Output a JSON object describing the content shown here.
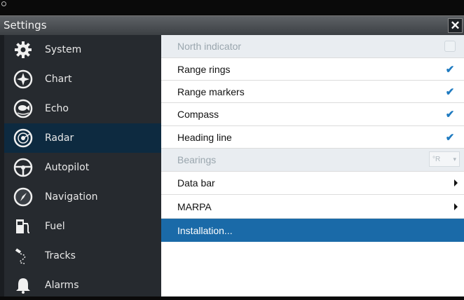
{
  "window": {
    "title": "Settings",
    "close_icon": "close-icon"
  },
  "sidebar": {
    "items": [
      {
        "label": "System",
        "icon": "gear-icon",
        "selected": false
      },
      {
        "label": "Chart",
        "icon": "chart-compass-icon",
        "selected": false
      },
      {
        "label": "Echo",
        "icon": "echo-fish-icon",
        "selected": false
      },
      {
        "label": "Radar",
        "icon": "radar-icon",
        "selected": true
      },
      {
        "label": "Autopilot",
        "icon": "steering-wheel-icon",
        "selected": false
      },
      {
        "label": "Navigation",
        "icon": "compass-needle-icon",
        "selected": false
      },
      {
        "label": "Fuel",
        "icon": "fuel-pump-icon",
        "selected": false
      },
      {
        "label": "Tracks",
        "icon": "tracks-icon",
        "selected": false
      },
      {
        "label": "Alarms",
        "icon": "bell-icon",
        "selected": false
      }
    ]
  },
  "options": [
    {
      "label": "North indicator",
      "control": "checkbox",
      "checked": false,
      "disabled": true
    },
    {
      "label": "Range rings",
      "control": "checkbox",
      "checked": true,
      "disabled": false
    },
    {
      "label": "Range markers",
      "control": "checkbox",
      "checked": true,
      "disabled": false
    },
    {
      "label": "Compass",
      "control": "checkbox",
      "checked": true,
      "disabled": false
    },
    {
      "label": "Heading line",
      "control": "checkbox",
      "checked": true,
      "disabled": false
    },
    {
      "label": "Bearings",
      "control": "dropdown",
      "value": "°R",
      "disabled": true
    },
    {
      "label": "Data bar",
      "control": "submenu",
      "disabled": false
    },
    {
      "label": "MARPA",
      "control": "submenu",
      "disabled": false
    },
    {
      "label": "Installation...",
      "control": "none",
      "selected": true
    }
  ],
  "colors": {
    "selected_sidebar": "#0d2a40",
    "selected_row": "#1a6aa8",
    "check": "#1e7ac0"
  }
}
